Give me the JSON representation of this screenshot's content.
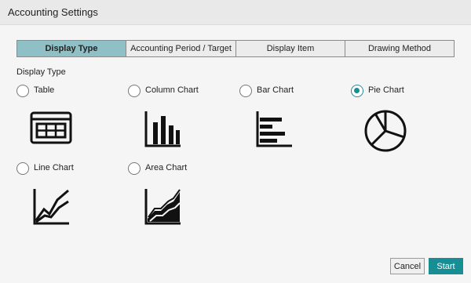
{
  "window": {
    "title": "Accounting Settings"
  },
  "tabs": [
    {
      "label": "Display Type",
      "active": true
    },
    {
      "label": "Accounting Period / Target",
      "active": false
    },
    {
      "label": "Display Item",
      "active": false
    },
    {
      "label": "Drawing Method",
      "active": false
    }
  ],
  "display_type": {
    "section_label": "Display Type",
    "selected": "Pie Chart",
    "options": [
      {
        "label": "Table",
        "icon": "table-icon",
        "checked": false
      },
      {
        "label": "Column Chart",
        "icon": "column-chart-icon",
        "checked": false
      },
      {
        "label": "Bar Chart",
        "icon": "bar-chart-icon",
        "checked": false
      },
      {
        "label": "Pie Chart",
        "icon": "pie-chart-icon",
        "checked": true
      },
      {
        "label": "Line Chart",
        "icon": "line-chart-icon",
        "checked": false
      },
      {
        "label": "Area Chart",
        "icon": "area-chart-icon",
        "checked": false
      }
    ]
  },
  "buttons": {
    "cancel": "Cancel",
    "start": "Start"
  },
  "colors": {
    "accent": "#178d94",
    "active_tab": "#8fc0c6"
  }
}
